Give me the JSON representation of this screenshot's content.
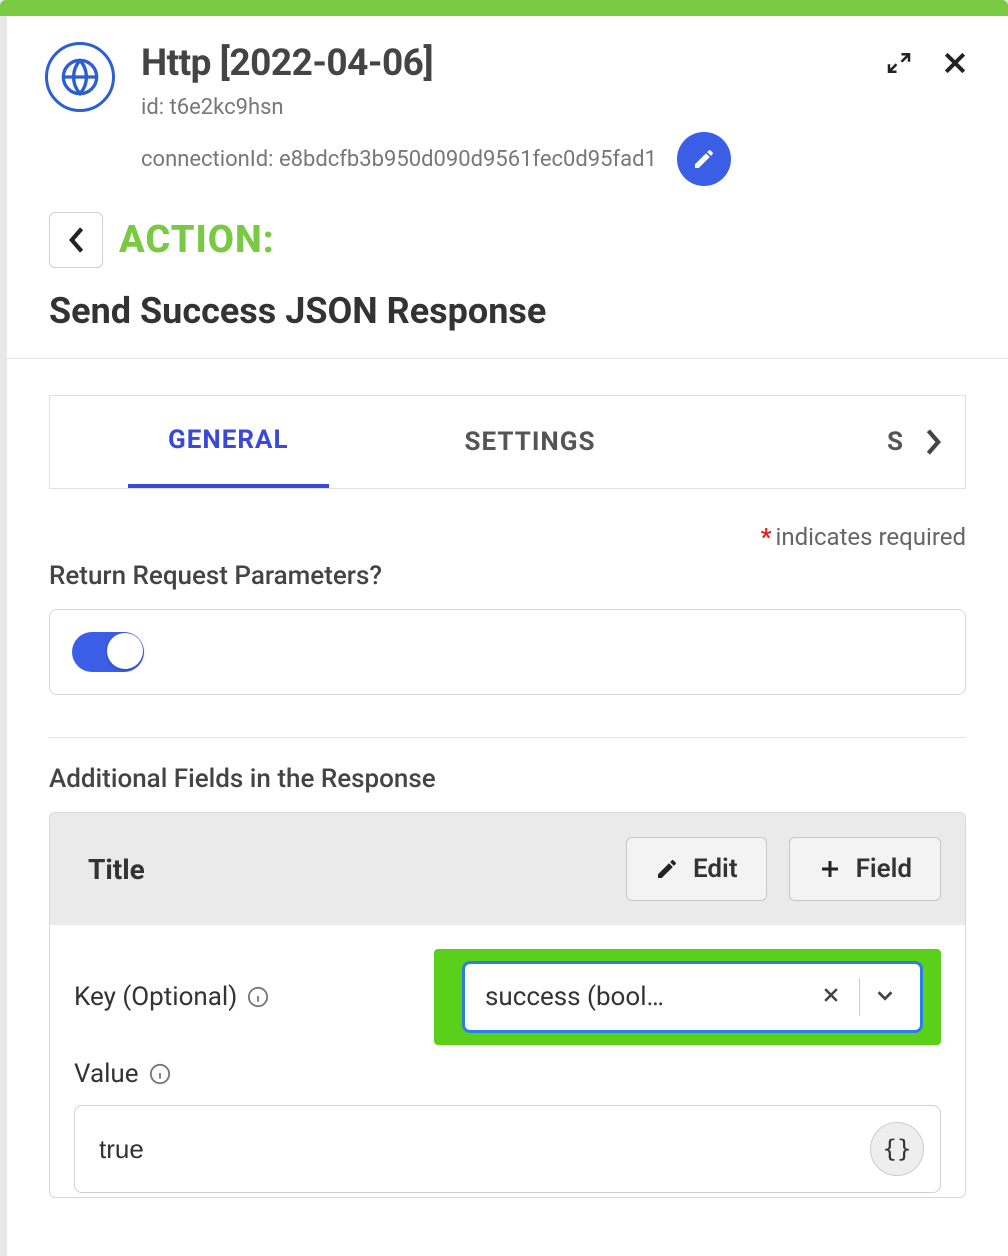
{
  "header": {
    "title": "Http [2022-04-06]",
    "id_label": "id: t6e2kc9hsn",
    "connection_label": "connectionId: e8bdcfb3b950d090d9561fec0d95fad1"
  },
  "action": {
    "label": "ACTION:",
    "name": "Send Success JSON Response"
  },
  "tabs": {
    "general": "GENERAL",
    "settings": "SETTINGS",
    "partial": "S"
  },
  "required_note": "indicates required",
  "required_asterisk": "*",
  "return_params": {
    "label": "Return Request Parameters?",
    "value": true
  },
  "additional": {
    "section_label": "Additional Fields in the Response",
    "title": "Title",
    "edit_btn": "Edit",
    "field_btn": "Field",
    "key_label": "Key (Optional)",
    "key_value": "success (bool…",
    "value_label": "Value",
    "value_value": "true",
    "brace": "{}"
  }
}
